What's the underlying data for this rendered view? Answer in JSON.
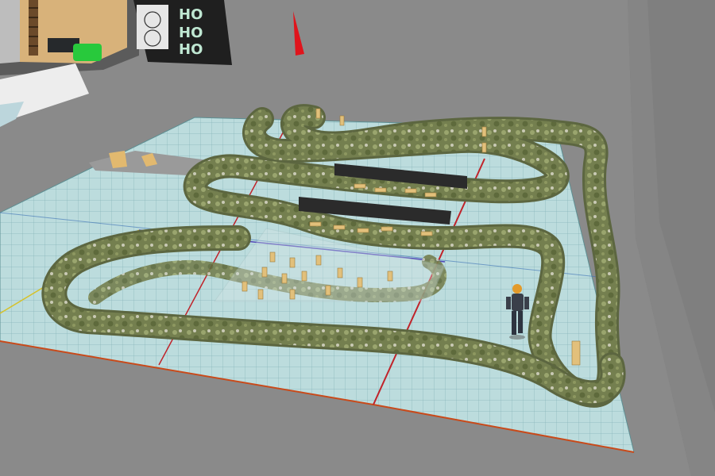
{
  "scene": {
    "type": "3d-virtual-world-viewport",
    "description_free": true,
    "colors": {
      "background_floor": "#8a8a8a",
      "right_wall": "#7f7f7f",
      "right_wall_far": "#8c8c8c",
      "grid_tile": "#b7d8d9",
      "grid_line": "#7fb0b4",
      "track_moss": "#6e7a4a",
      "track_edge": "#a8b27a",
      "dark_panel": "#2b2b2b",
      "marker_red": "#e0141c",
      "platform_wood": "#e2b96f",
      "poster_bg": "#1f1f1f",
      "poster_letters": "#bfe7d2",
      "green_object": "#28c93c",
      "avatar_shirt": "#3a3f4a",
      "avatar_hat": "#e39a2a",
      "pylon_wood": "#e2c07b"
    },
    "poster": {
      "letters": [
        "HO",
        "HO",
        "HO"
      ]
    },
    "objects": {
      "avatar": "avatar-figure",
      "red_marker": "direction-marker",
      "barriers": [
        "barrier-wall-1",
        "barrier-wall-2"
      ],
      "pylon_groups": [
        "top-loop-pylons",
        "middle-pylons",
        "lower-pylons",
        "right-loop-pylon"
      ]
    }
  }
}
